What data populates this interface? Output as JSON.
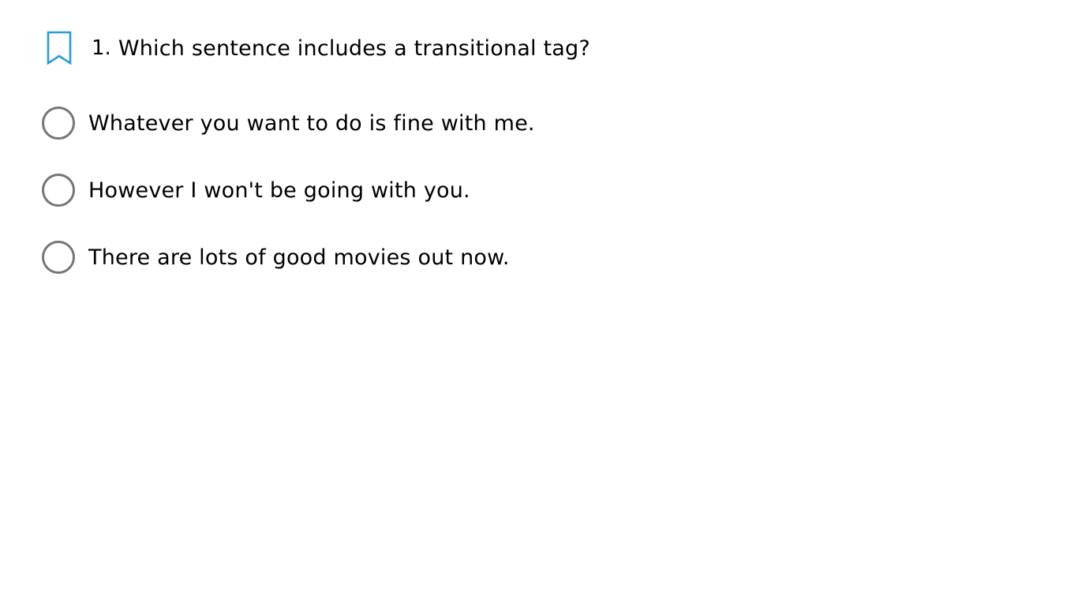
{
  "question": {
    "number": "1.",
    "text": "Which sentence includes a transitional tag?",
    "bookmark_icon": "bookmark-icon",
    "bookmark_color": "#2A9AD9"
  },
  "options": [
    {
      "label": "Whatever you want to do is fine with me.",
      "selected": false
    },
    {
      "label": "However I won't be going with you.",
      "selected": false
    },
    {
      "label": "There are lots of good movies out now.",
      "selected": false
    }
  ],
  "colors": {
    "radio_border": "#767676",
    "text": "#000000",
    "background": "#FFFFFF"
  }
}
